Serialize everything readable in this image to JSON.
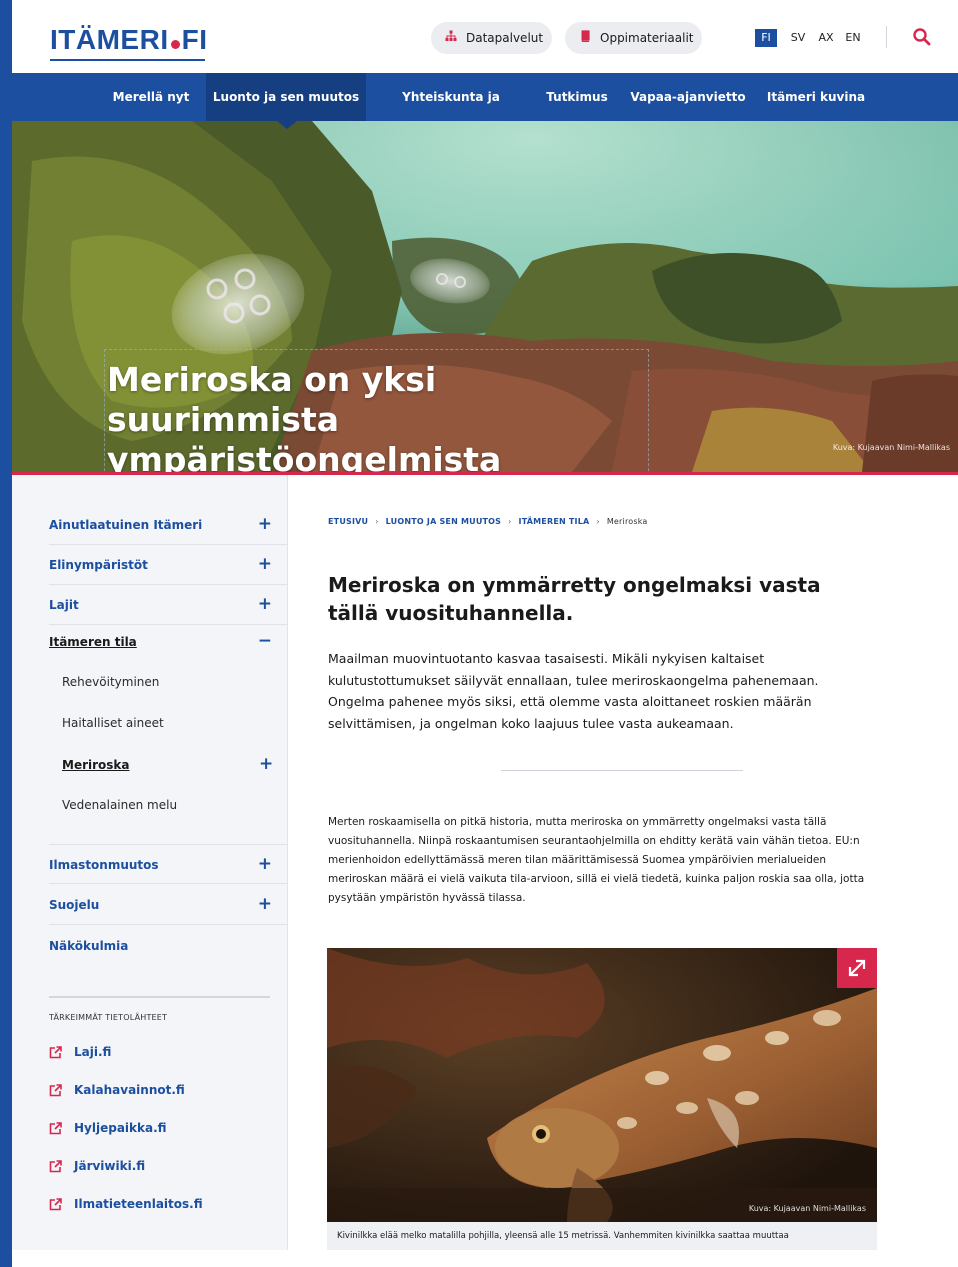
{
  "header": {
    "logo_left": "ITÄMERI",
    "logo_right": "FI",
    "datapalvelut": "Datapalvelut",
    "oppimateriaalit": "Oppimateriaalit",
    "languages": [
      "FI",
      "SV",
      "AX",
      "EN"
    ],
    "active_language": "FI"
  },
  "nav": {
    "items": [
      "Merellä nyt",
      "Luonto ja sen muutos",
      "Yhteiskunta ja Itämeri",
      "Tutkimus",
      "Vapaa-ajanvietto",
      "Itämeri kuvina"
    ],
    "active": "Luonto ja sen muutos"
  },
  "hero": {
    "title_line1": "Meriroska on yksi suurimmista",
    "title_line2": "ympäristöongelmista",
    "credit": "Kuva: Kujaavan Nimi-Mallikas"
  },
  "sidebar": {
    "items": [
      {
        "label": "Ainutlaatuinen Itämeri",
        "toggle": "+"
      },
      {
        "label": "Elinympäristöt",
        "toggle": "+"
      },
      {
        "label": "Lajit",
        "toggle": "+"
      },
      {
        "label": "Itämeren tila",
        "toggle": "−"
      }
    ],
    "subitems": [
      "Rehevöityminen",
      "Haitalliset aineet",
      "Meriroska",
      "Vedenalainen melu"
    ],
    "subitem_toggle": "+",
    "items_after": [
      {
        "label": "Ilmastonmuutos",
        "toggle": "+"
      },
      {
        "label": "Suojelu",
        "toggle": "+"
      },
      {
        "label": "Näkökulmia",
        "toggle": ""
      }
    ],
    "sources_heading": "TÄRKEIMMÄT TIETOLÄHTEET",
    "sources": [
      "Laji.fi",
      "Kalahavainnot.fi",
      "Hyljepaikka.fi",
      "Järviwiki.fi",
      "Ilmatieteenlaitos.fi"
    ]
  },
  "breadcrumb": {
    "items": [
      "ETUSIVU",
      "LUONTO JA SEN MUUTOS",
      "ITÄMEREN TILA"
    ],
    "separator": "›",
    "current": "Meriroska"
  },
  "article": {
    "heading": "Meriroska on ymmärretty ongelmaksi vasta tällä vuosituhannella.",
    "lead": "Maailman muovintuotanto kasvaa tasaisesti. Mikäli nykyisen kaltaiset kulutustottumukset säilyvät ennallaan, tulee meriroskaongelma pahenemaan. Ongelma pahenee myös siksi, että olemme vasta aloittaneet roskien määrän selvittämisen, ja ongelman koko laajuus tulee vasta aukeamaan.",
    "body": "Merten roskaamisella on pitkä historia, mutta meriroska on ymmärretty ongelmaksi vasta tällä vuosituhannella. Niinpä roskaantumisen seurantaohjelmilla on ehditty kerätä vain vähän tietoa. EU:n merienhoidon edellyttämässä meren tilan määrittämisessä Suomea ympäröivien merialueiden meriroskan määrä ei vielä vaikuta tila-arvioon, sillä ei vielä tiedetä, kuinka paljon roskia saa olla, jotta pysytään ympäristön hyvässä tilassa.",
    "figure_credit": "Kuva: Kujaavan Nimi-Mallikas",
    "caption": "Kivinilkka elää melko matalilla pohjilla, yleensä alle 15 metrissä. Vanhemmiten kivinilkka saattaa muuttaa"
  },
  "colors": {
    "brand_blue": "#1d4fa0",
    "nav_active": "#163f82",
    "accent_red": "#d8274d",
    "sidebar_bg": "#f3f5f8"
  }
}
